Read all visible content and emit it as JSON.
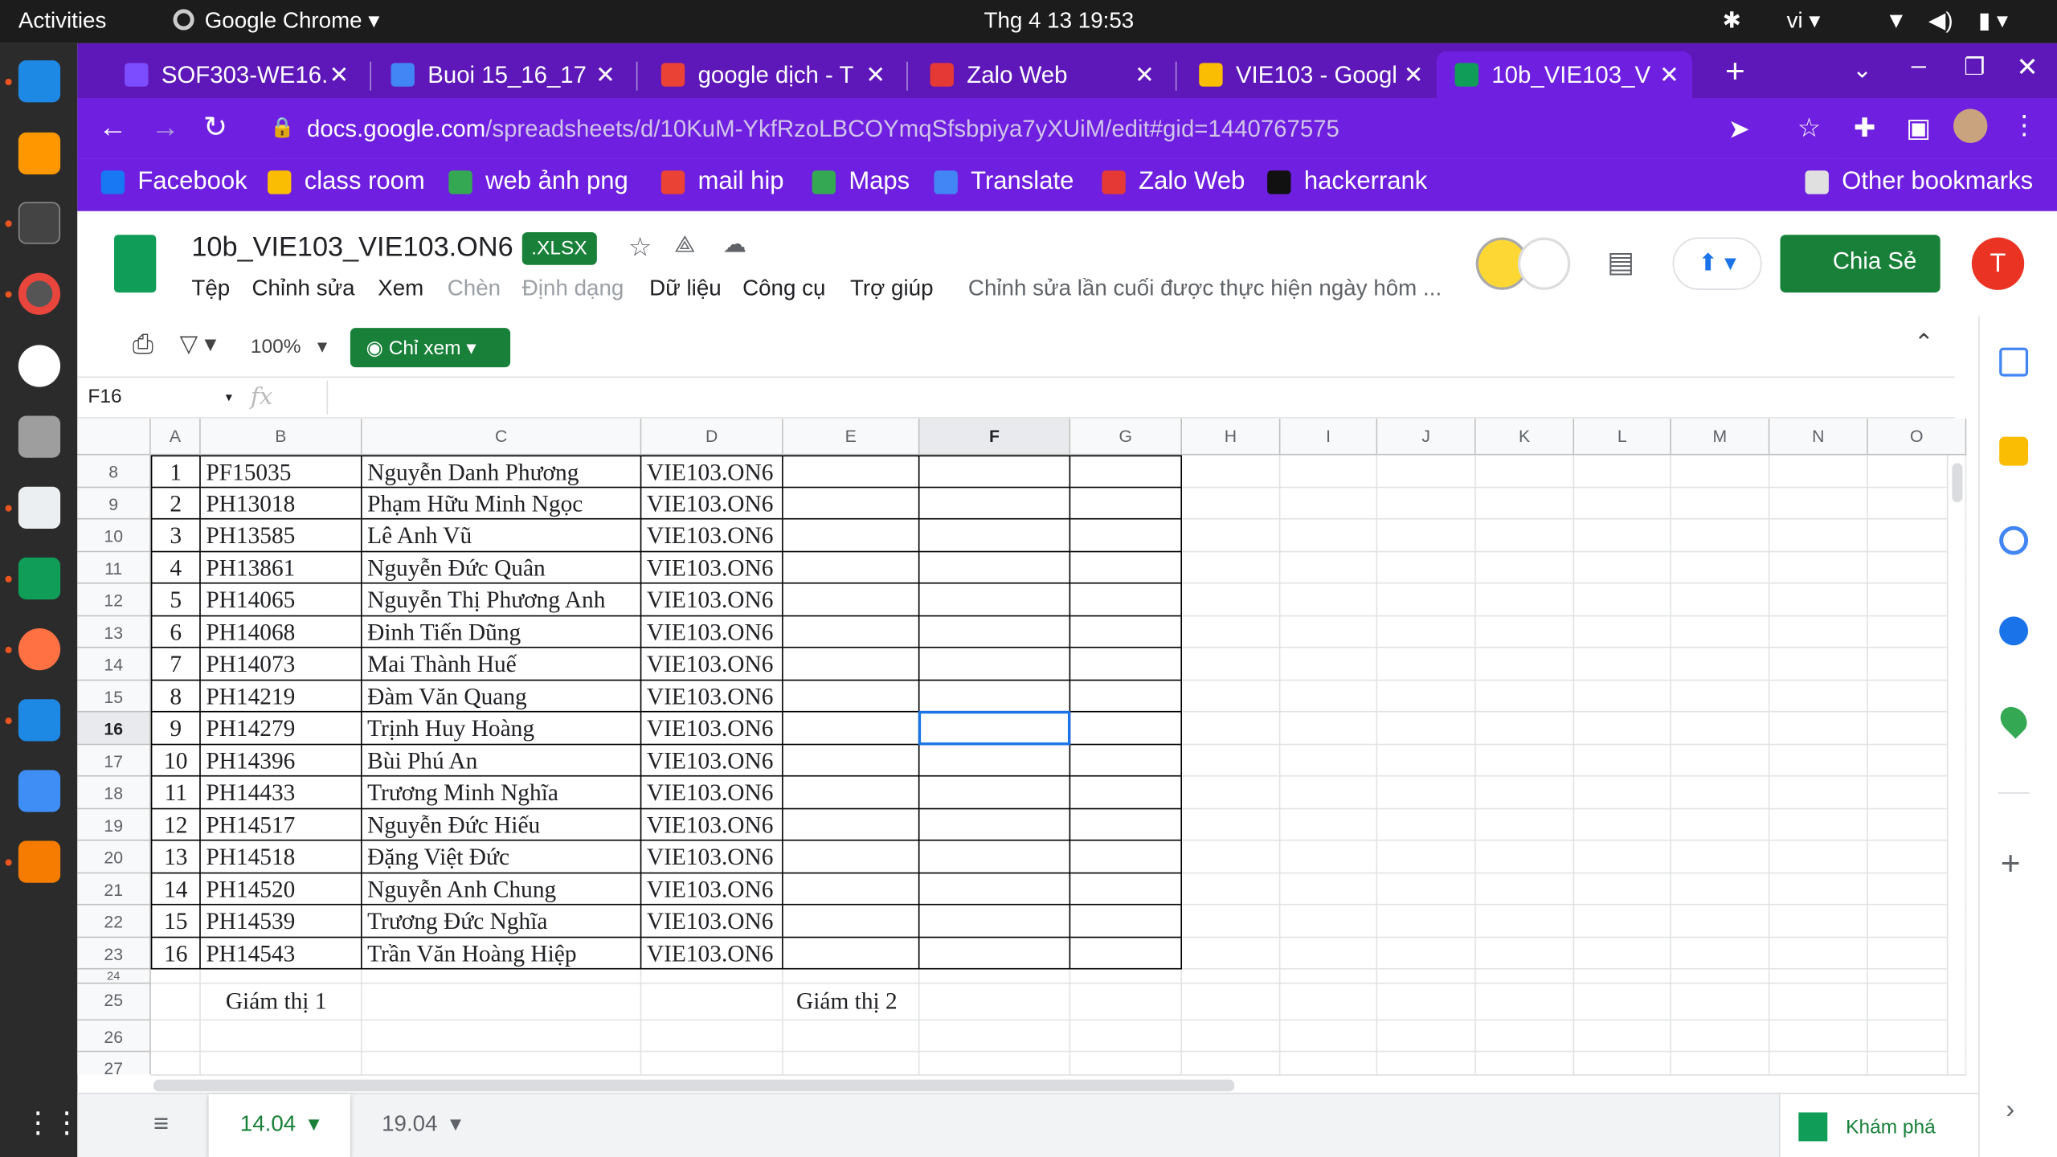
{
  "system": {
    "activities": "Activities",
    "app": "Google Chrome",
    "clock": "Thg 4 13  19:53",
    "lang": "vi"
  },
  "tabs": [
    {
      "label": "SOF303-WE16.",
      "color": "#7c4dff"
    },
    {
      "label": "Buoi 15_16_17",
      "color": "#4285f4"
    },
    {
      "label": "google dịch - T",
      "color": "#ea4335"
    },
    {
      "label": "Zalo Web",
      "color": "#e53935"
    },
    {
      "label": "VIE103 - Googl",
      "color": "#fbbc04"
    },
    {
      "label": "10b_VIE103_V",
      "color": "#0f9d58"
    }
  ],
  "url": {
    "host": "docs.google.com",
    "path": "/spreadsheets/d/10KuM-YkfRzoLBCOYmqSfsbpiya7yXUiM/edit#gid=1440767575"
  },
  "bookmarks": [
    {
      "label": "Facebook",
      "color": "#1877f2"
    },
    {
      "label": "class room",
      "color": "#fbbc04"
    },
    {
      "label": "web ảnh png",
      "color": "#34a853"
    },
    {
      "label": "mail hip",
      "color": "#ea4335"
    },
    {
      "label": "Maps",
      "color": "#34a853"
    },
    {
      "label": "Translate",
      "color": "#4285f4"
    },
    {
      "label": "Zalo Web",
      "color": "#e53935"
    },
    {
      "label": "hackerrank",
      "color": "#111111"
    }
  ],
  "other_bookmarks": "Other bookmarks",
  "doc": {
    "title": "10b_VIE103_VIE103.ON6",
    "badge": ".XLSX",
    "last_edit": "Chỉnh sửa lần cuối được thực hiện ngày hôm ...",
    "share": "Chia Sẻ",
    "avatar": "T"
  },
  "menu": [
    "Tệp",
    "Chỉnh sửa",
    "Xem",
    "Chèn",
    "Định dạng",
    "Dữ liệu",
    "Công cụ",
    "Trợ giúp"
  ],
  "toolbar": {
    "zoom": "100%",
    "view_only": "Chỉ xem"
  },
  "formula": {
    "cell_ref": "F16",
    "fx": "fx"
  },
  "columns": [
    "A",
    "B",
    "C",
    "D",
    "E",
    "F",
    "G",
    "H",
    "I",
    "J",
    "K",
    "L",
    "M",
    "N",
    "O"
  ],
  "rows": [
    {
      "n": "8",
      "a": "1",
      "b": "PF15035",
      "c": "Nguyễn Danh Phương",
      "d": "VIE103.ON6"
    },
    {
      "n": "9",
      "a": "2",
      "b": "PH13018",
      "c": "Phạm Hữu Minh Ngọc",
      "d": "VIE103.ON6"
    },
    {
      "n": "10",
      "a": "3",
      "b": "PH13585",
      "c": "Lê Anh Vũ",
      "d": "VIE103.ON6"
    },
    {
      "n": "11",
      "a": "4",
      "b": "PH13861",
      "c": "Nguyễn Đức Quân",
      "d": "VIE103.ON6"
    },
    {
      "n": "12",
      "a": "5",
      "b": "PH14065",
      "c": "Nguyễn Thị Phương Anh",
      "d": "VIE103.ON6"
    },
    {
      "n": "13",
      "a": "6",
      "b": "PH14068",
      "c": "Đinh Tiến Dũng",
      "d": "VIE103.ON6"
    },
    {
      "n": "14",
      "a": "7",
      "b": "PH14073",
      "c": "Mai Thành Huế",
      "d": "VIE103.ON6"
    },
    {
      "n": "15",
      "a": "8",
      "b": "PH14219",
      "c": "Đàm Văn Quang",
      "d": "VIE103.ON6"
    },
    {
      "n": "16",
      "a": "9",
      "b": "PH14279",
      "c": "Trịnh Huy Hoàng",
      "d": "VIE103.ON6"
    },
    {
      "n": "17",
      "a": "10",
      "b": "PH14396",
      "c": "Bùi Phú An",
      "d": "VIE103.ON6"
    },
    {
      "n": "18",
      "a": "11",
      "b": "PH14433",
      "c": "Trương Minh Nghĩa",
      "d": "VIE103.ON6"
    },
    {
      "n": "19",
      "a": "12",
      "b": "PH14517",
      "c": "Nguyễn Đức Hiếu",
      "d": "VIE103.ON6"
    },
    {
      "n": "20",
      "a": "13",
      "b": "PH14518",
      "c": "Đặng Việt Đức",
      "d": "VIE103.ON6"
    },
    {
      "n": "21",
      "a": "14",
      "b": "PH14520",
      "c": "Nguyễn Anh Chung",
      "d": "VIE103.ON6"
    },
    {
      "n": "22",
      "a": "15",
      "b": "PH14539",
      "c": "Trương Đức Nghĩa",
      "d": "VIE103.ON6"
    },
    {
      "n": "23",
      "a": "16",
      "b": "PH14543",
      "c": "Trần Văn Hoàng Hiệp",
      "d": "VIE103.ON6"
    }
  ],
  "extra_rows": [
    "24",
    "25",
    "26",
    "27"
  ],
  "footer": {
    "proctor1": "Giám thị 1",
    "proctor2": "Giám thị 2"
  },
  "sheets": [
    {
      "label": "14.04"
    },
    {
      "label": "19.04"
    }
  ],
  "explore": "Khám phá"
}
